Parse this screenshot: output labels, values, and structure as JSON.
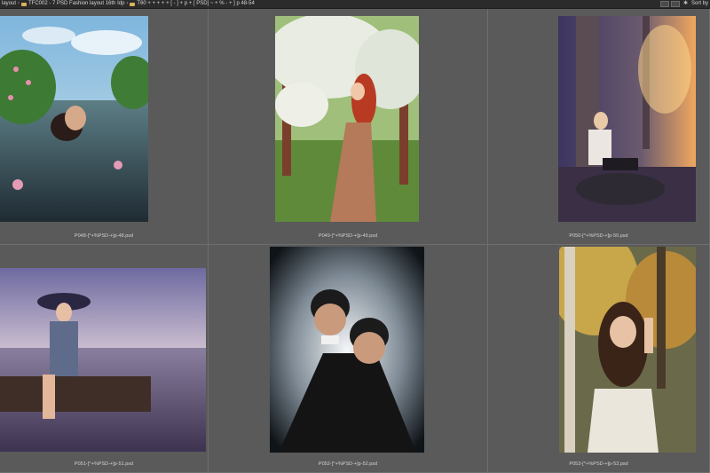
{
  "titlebar": {
    "path_1": "layout",
    "path_2": "TFC002 - 7 PSD Fashion layout 16th Idp",
    "path_3": "T60 + + + + + [ - ] + p + [ PSD] ~ + % - + ] p 48-54",
    "sort_label": "Sort by"
  },
  "items": [
    {
      "filename": "P048-[^+%PSD-+]p-48.psd"
    },
    {
      "filename": "P049-[^+%PSD-+]p-49.psd"
    },
    {
      "filename": "P050-[^+%PSD-+]p-50.psd"
    },
    {
      "filename": "P051-[^+%PSD-+]p-51.psd"
    },
    {
      "filename": "P052-[^+%PSD-+]p-52.psd"
    },
    {
      "filename": "P053-[^+%PSD-+]p-53.psd"
    }
  ],
  "icons": [
    "folder-icon",
    "chevron-right-icon",
    "view-toggle-icon",
    "settings-icon"
  ]
}
